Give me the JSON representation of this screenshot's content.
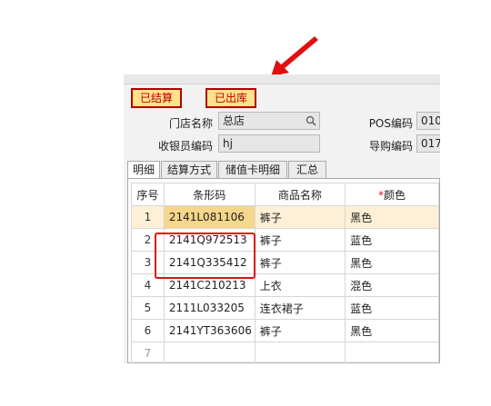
{
  "status_badges": [
    "已结算",
    "已出库"
  ],
  "fields": {
    "store_name_label": "门店名称",
    "store_name_value": "总店",
    "cashier_code_label": "收银员编码",
    "cashier_code_value": "hj",
    "pos_code_label": "POS编码",
    "pos_code_value": "010",
    "guide_code_label": "导购编码",
    "guide_code_value": "017"
  },
  "tabs": [
    "明细",
    "结算方式",
    "储值卡明细",
    "汇总"
  ],
  "table": {
    "headers": [
      "序号",
      "条形码",
      "商品名称",
      "*颜色"
    ],
    "required_mark": "*",
    "color_header": "颜色",
    "rows": [
      {
        "no": "1",
        "barcode": "2141L081106",
        "name": "裤子",
        "color": "黑色"
      },
      {
        "no": "2",
        "barcode": "2141Q972513",
        "name": "裤子",
        "color": "蓝色"
      },
      {
        "no": "3",
        "barcode": "2141Q335412",
        "name": "裤子",
        "color": "黑色"
      },
      {
        "no": "4",
        "barcode": "2141C210213",
        "name": "上衣",
        "color": "混色"
      },
      {
        "no": "5",
        "barcode": "2111L033205",
        "name": "连衣裙子",
        "color": "蓝色"
      },
      {
        "no": "6",
        "barcode": "2141YT363606",
        "name": "裤子",
        "color": "黑色"
      },
      {
        "no": "7",
        "barcode": "",
        "name": "",
        "color": ""
      }
    ]
  },
  "colors": {
    "badge_bg": "#ffe38a",
    "badge_border": "#b30000",
    "highlight_box": "#e01010",
    "arrow": "#e01010"
  }
}
